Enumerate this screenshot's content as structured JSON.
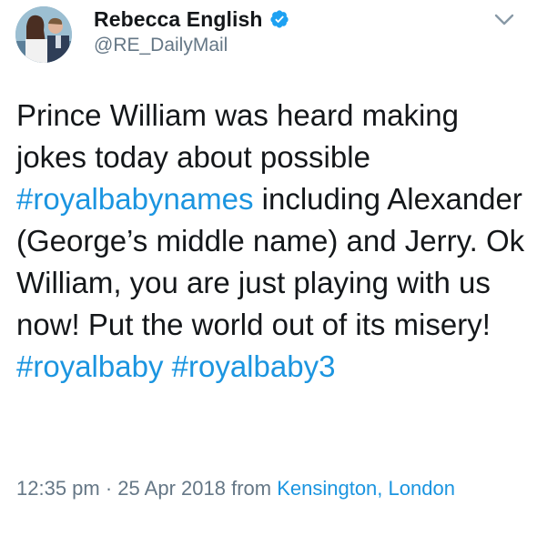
{
  "user": {
    "display_name": "Rebecca English",
    "handle": "@RE_DailyMail",
    "verified": true
  },
  "tweet": {
    "text_before": "Prince William was heard making jokes today about possible ",
    "hashtag1": "#royalbabynames",
    "text_middle": " including Alexander (George’s middle name) and Jerry. Ok William, you are just playing with us now! Put the world out of its misery! ",
    "hashtag2": "#royalbaby",
    "hashtag3": "#royalbaby3"
  },
  "meta": {
    "time": "12:35 pm",
    "separator": " · ",
    "date": "25 Apr 2018",
    "from": " from ",
    "place": "Kensington, London"
  },
  "icons": {
    "verified": "verified-badge-icon",
    "chevron": "chevron-down-icon"
  },
  "colors": {
    "link": "#1b95e0",
    "muted": "#657786",
    "text": "#14171a",
    "verified": "#1da1f2"
  }
}
